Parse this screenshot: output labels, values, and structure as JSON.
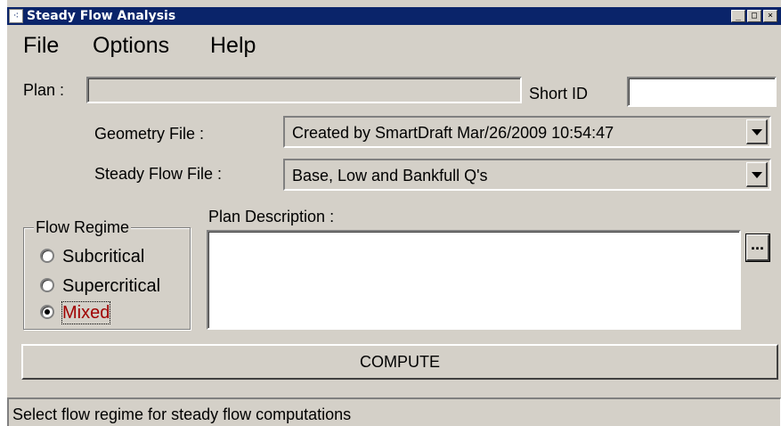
{
  "window": {
    "title": "Steady Flow Analysis",
    "icon": "app-icon",
    "controls": {
      "minimize": "_",
      "maximize": "□",
      "close": "×"
    }
  },
  "menu": [
    "File",
    "Options",
    "Help"
  ],
  "plan": {
    "label": "Plan :",
    "value": ""
  },
  "short_id": {
    "label": "Short ID",
    "value": ""
  },
  "geometry": {
    "label": "Geometry File :",
    "selected": "Created by SmartDraft Mar/26/2009 10:54:47"
  },
  "steady_flow": {
    "label": "Steady Flow File :",
    "selected": "Base, Low and Bankfull Q's"
  },
  "flow_regime": {
    "title": "Flow Regime",
    "options": [
      "Subcritical",
      "Supercritical",
      "Mixed"
    ],
    "selected": "Mixed"
  },
  "plan_description": {
    "label": "Plan Description :",
    "value": "",
    "browse_label": "..."
  },
  "compute_label": "COMPUTE",
  "status_text": "Select flow regime for steady flow computations"
}
